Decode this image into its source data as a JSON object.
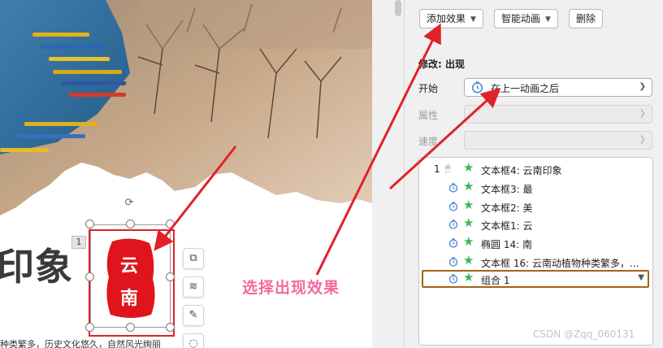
{
  "slide": {
    "title": "印象",
    "body_text": "种类繁多，历史文化悠久，自然风光绚丽",
    "shape_number": "1",
    "stamp_chars": [
      "云",
      "南"
    ],
    "annotation": "选择出现效果"
  },
  "toolbar": {
    "add_effect": "添加效果",
    "smart_animation": "智能动画",
    "delete": "删除"
  },
  "modify": {
    "section_title": "修改: 出现",
    "start_label": "开始",
    "start_value": "在上一动画之后",
    "property_label": "属性",
    "speed_label": "速度"
  },
  "animation_list": [
    {
      "index": "1",
      "trigger": "mouse",
      "label": "文本框4: 云南印象",
      "selected": false
    },
    {
      "index": "",
      "trigger": "clock",
      "label": "文本框3: 最",
      "selected": false
    },
    {
      "index": "",
      "trigger": "clock",
      "label": "文本框2: 美",
      "selected": false
    },
    {
      "index": "",
      "trigger": "clock",
      "label": "文本框1: 云",
      "selected": false
    },
    {
      "index": "",
      "trigger": "clock",
      "label": "椭圆 14: 南",
      "selected": false
    },
    {
      "index": "",
      "trigger": "clock",
      "label": "文本框 16: 云南动植物种类繁多，...",
      "selected": false
    },
    {
      "index": "",
      "trigger": "clock",
      "label": "组合 1",
      "selected": true
    }
  ],
  "watermark": "CSDN @Zqq_060131",
  "colors": {
    "arrow_red": "#e0222a",
    "annotation_pink": "#f36aa0",
    "stamp_red": "#e0141c",
    "star_green": "#3cb55b",
    "selected_border": "#a5611a"
  },
  "icons": [
    "rotate-icon",
    "crop-icon",
    "layers-icon",
    "pen-icon",
    "clock-icon",
    "mouse-icon",
    "star-icon",
    "chevron-down-icon"
  ]
}
